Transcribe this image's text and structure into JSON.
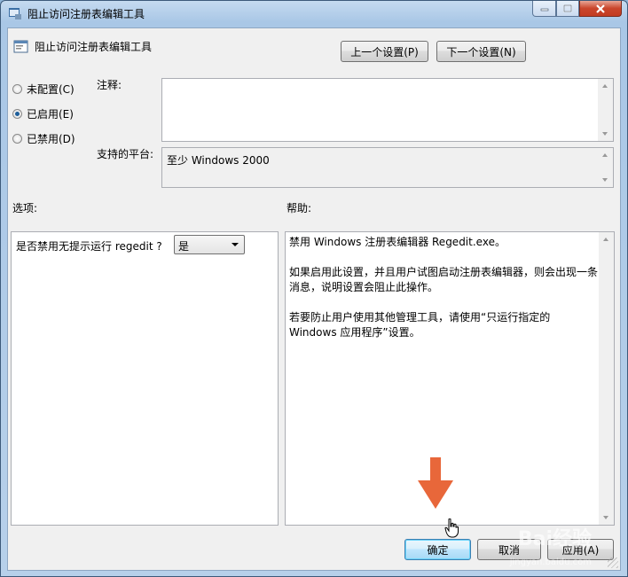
{
  "window": {
    "title": "阻止访问注册表编辑工具",
    "minimize_icon": "minimize-icon",
    "maximize_icon": "maximize-icon",
    "close_icon": "close-icon"
  },
  "header": {
    "policy_title": "阻止访问注册表编辑工具",
    "prev_setting": "上一个设置(P)",
    "next_setting": "下一个设置(N)"
  },
  "state": {
    "options": [
      {
        "label": "未配置(C)",
        "selected": false
      },
      {
        "label": "已启用(E)",
        "selected": true
      },
      {
        "label": "已禁用(D)",
        "selected": false
      }
    ]
  },
  "comment": {
    "label": "注释:",
    "value": ""
  },
  "platform": {
    "label": "支持的平台:",
    "value": "至少 Windows 2000"
  },
  "options_panel": {
    "label": "选项:",
    "question": "是否禁用无提示运行 regedit ?",
    "selected": "是"
  },
  "help_panel": {
    "label": "帮助:",
    "paragraphs": [
      "禁用 Windows 注册表编辑器 Regedit.exe。",
      "如果启用此设置，并且用户试图启动注册表编辑器，则会出现一条消息，说明设置会阻止此操作。",
      "若要防止用户使用其他管理工具，请使用“只运行指定的 Windows 应用程序”设置。"
    ]
  },
  "footer": {
    "ok": "确定",
    "cancel": "取消",
    "apply": "应用(A)"
  },
  "colors": {
    "annotation_arrow": "#e8673a",
    "default_button_border": "#3c7fb1"
  }
}
